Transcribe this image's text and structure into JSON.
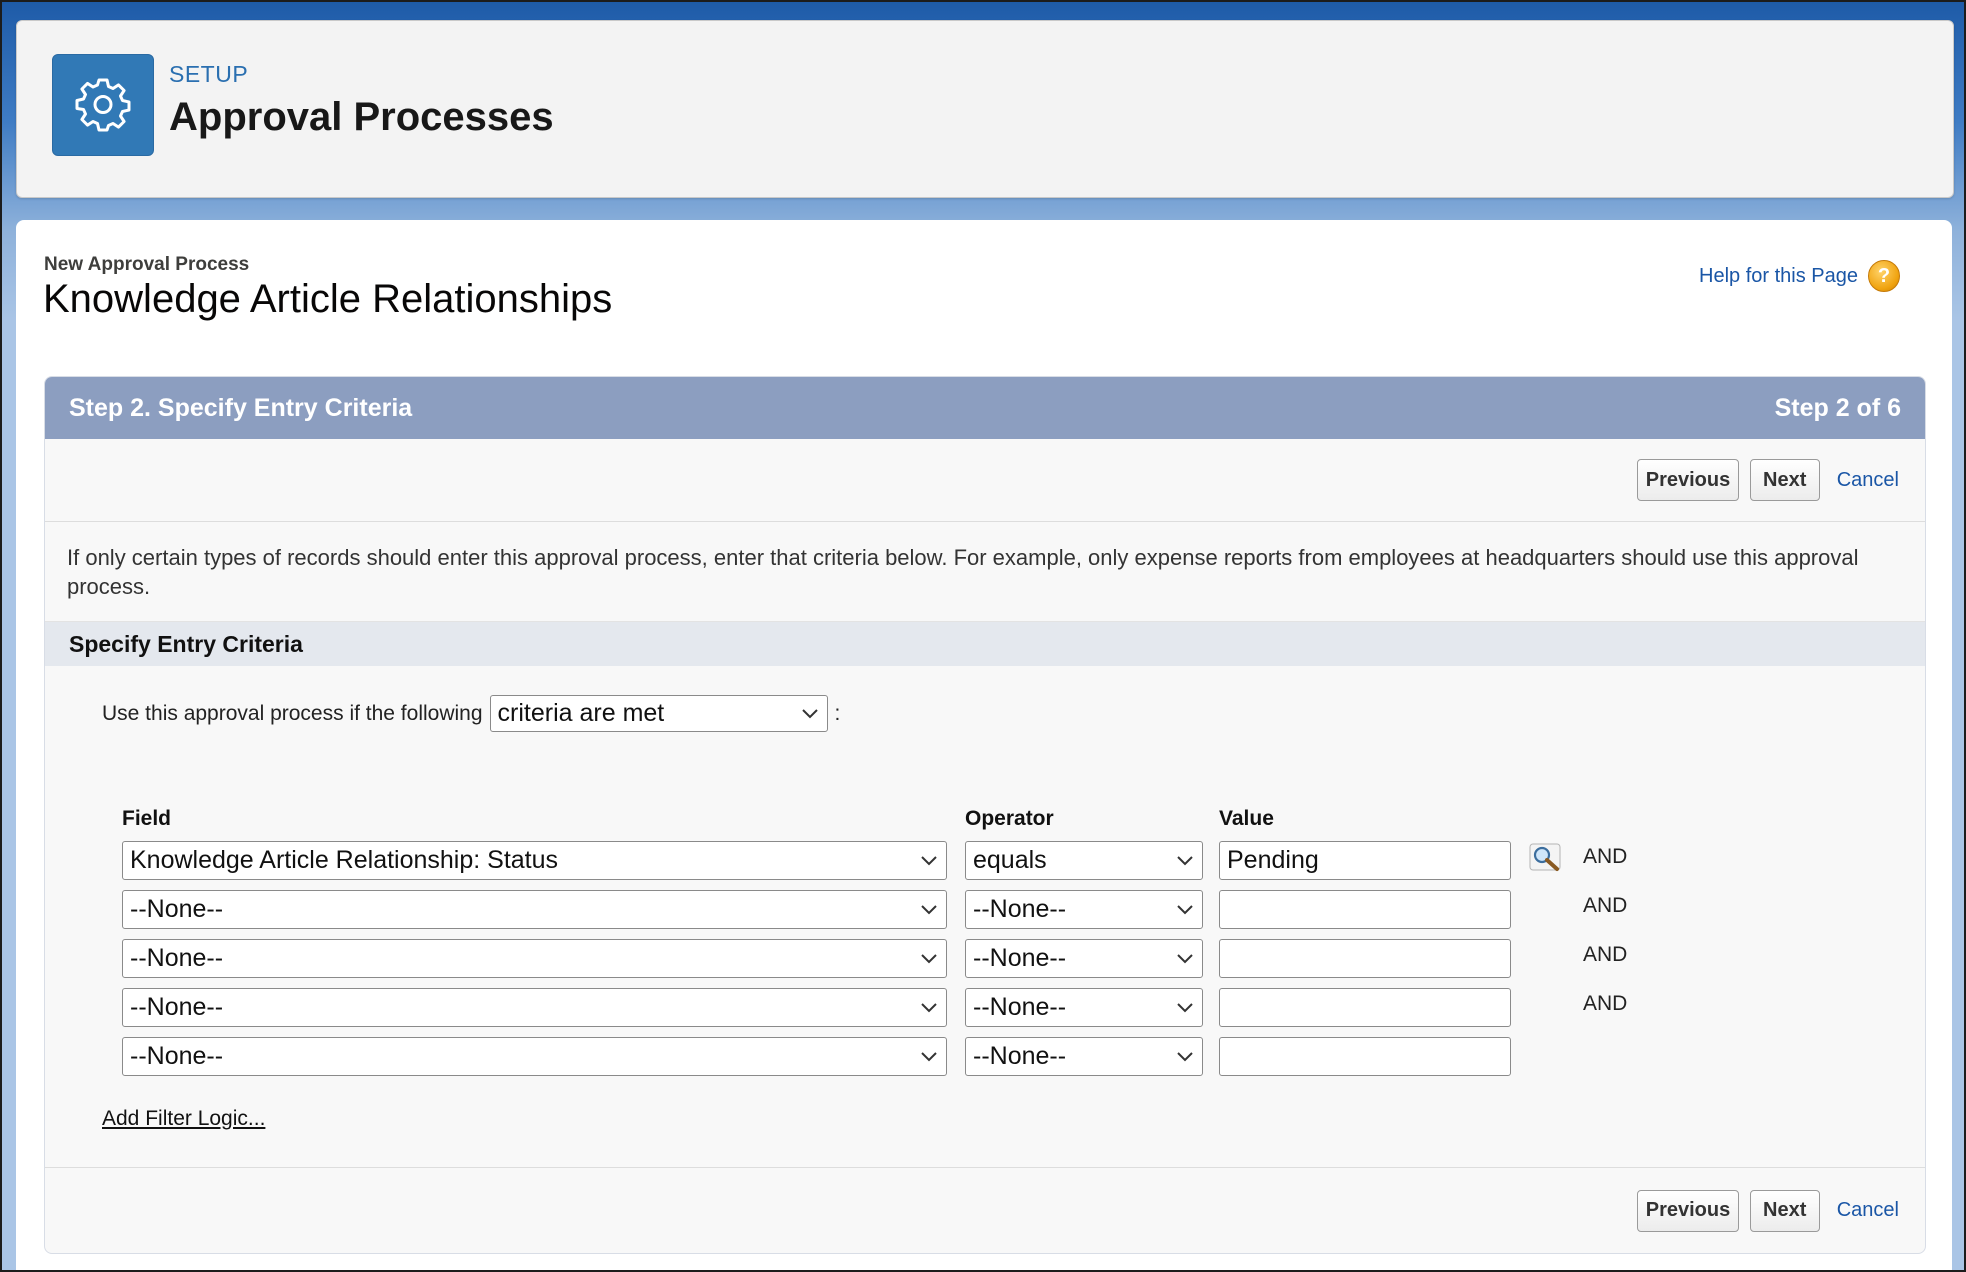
{
  "header": {
    "eyebrow": "SETUP",
    "title": "Approval Processes",
    "icon": "gear-icon"
  },
  "page": {
    "breadcrumb": "New Approval Process",
    "title": "Knowledge Article Relationships",
    "help_link": "Help for this Page",
    "help_icon_glyph": "?"
  },
  "step": {
    "title": "Step 2. Specify Entry Criteria",
    "counter": "Step 2 of 6"
  },
  "buttons": {
    "previous": "Previous",
    "next": "Next",
    "cancel": "Cancel"
  },
  "description": "If only certain types of records should enter this approval process, enter that criteria below. For example, only expense reports from employees at headquarters should use this approval process.",
  "section": {
    "title": "Specify Entry Criteria",
    "criteria_prefix": "Use this approval process if the following",
    "criteria_value": "criteria are met",
    "criteria_suffix": ":"
  },
  "columns": {
    "field": "Field",
    "operator": "Operator",
    "value": "Value"
  },
  "filters": [
    {
      "field": "Knowledge Article Relationship: Status",
      "operator": "equals",
      "value": "Pending",
      "connector": "AND"
    },
    {
      "field": "--None--",
      "operator": "--None--",
      "value": "",
      "connector": "AND"
    },
    {
      "field": "--None--",
      "operator": "--None--",
      "value": "",
      "connector": "AND"
    },
    {
      "field": "--None--",
      "operator": "--None--",
      "value": "",
      "connector": "AND"
    },
    {
      "field": "--None--",
      "operator": "--None--",
      "value": "",
      "connector": ""
    }
  ],
  "add_filter_logic": "Add Filter Logic...",
  "colors": {
    "brand_blue": "#1f5aa8",
    "step_header": "#8c9ec0",
    "link": "#1a56a6",
    "setup_icon_bg": "#3179b6"
  }
}
